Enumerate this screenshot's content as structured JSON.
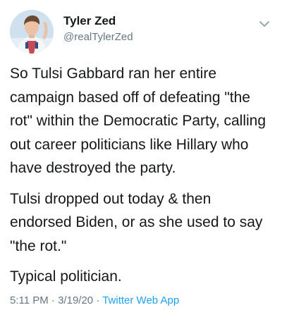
{
  "tweet": {
    "display_name": "Tyler Zed",
    "handle": "@realTylerZed",
    "paragraphs": [
      "So Tulsi Gabbard ran her entire campaign based off of defeating \"the rot\" within the Democratic Party, calling out career politicians like Hillary who have destroyed the party.",
      "Tulsi dropped out today & then endorsed Biden, or as she used to say \"the rot.\"",
      "Typical politician."
    ],
    "time": "5:11 PM",
    "date": "3/19/20",
    "separator": "·",
    "source": "Twitter Web App",
    "menu_icon": "chevron-down-icon"
  },
  "colors": {
    "text": "#14171a",
    "secondary": "#657786",
    "link": "#1da1f2"
  }
}
